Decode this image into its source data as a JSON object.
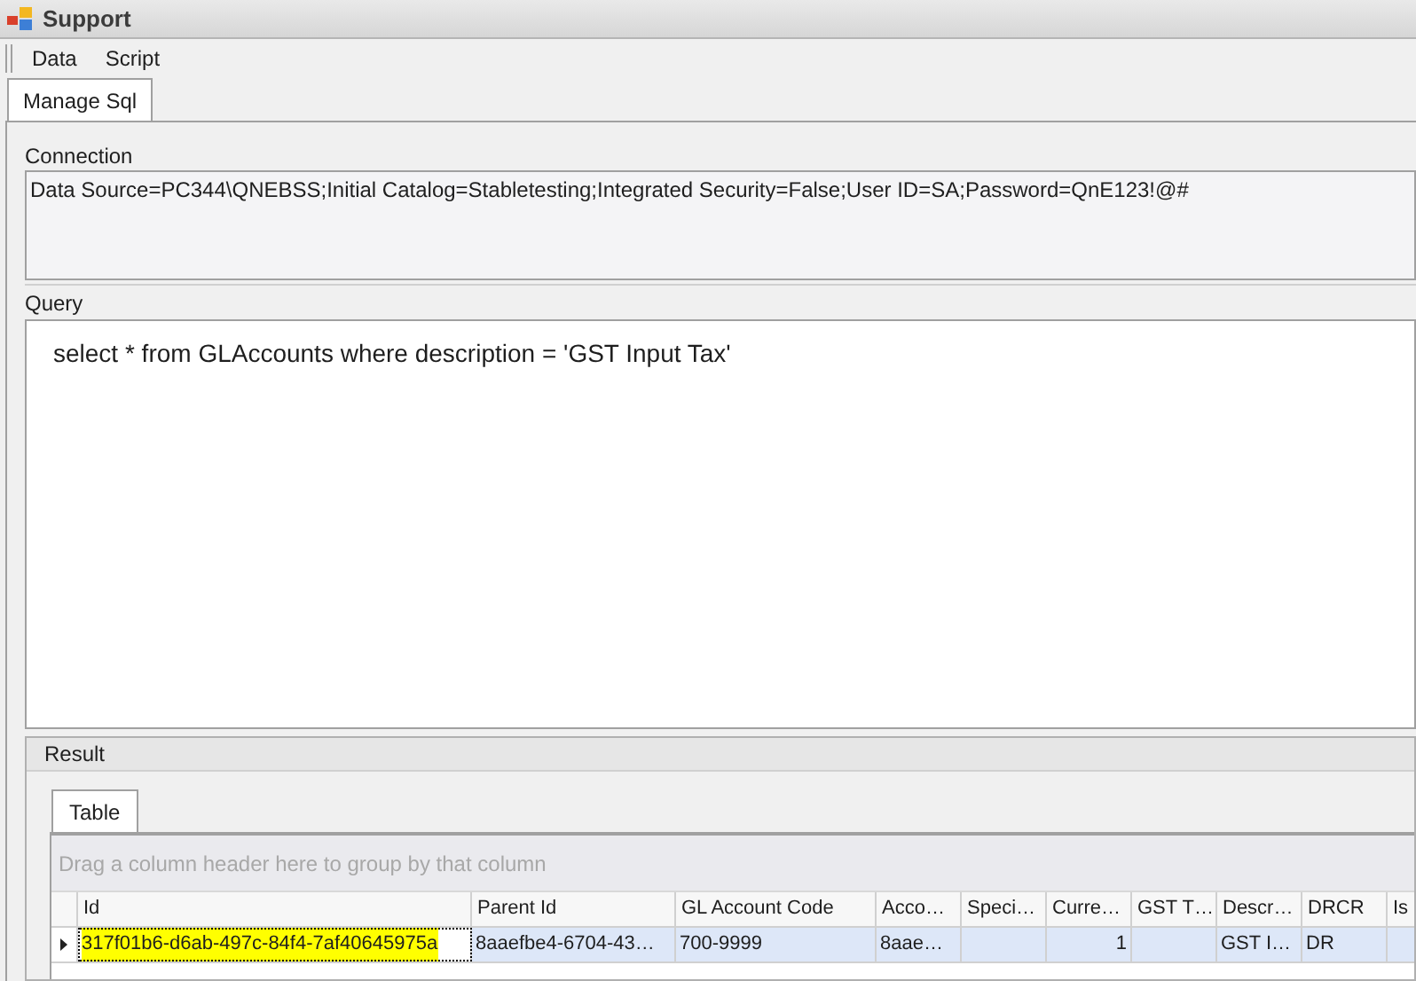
{
  "window": {
    "title": "Support"
  },
  "menu": [
    "Data",
    "Script"
  ],
  "tabs": [
    {
      "label": "Manage Sql",
      "selected": true
    }
  ],
  "connection": {
    "label": "Connection",
    "value": "Data Source=PC344\\QNEBSS;Initial Catalog=Stabletesting;Integrated Security=False;User ID=SA;Password=QnE123!@#"
  },
  "query": {
    "label": "Query",
    "value": "select * from GLAccounts where description = 'GST Input Tax'"
  },
  "result": {
    "label": "Result",
    "tabs": [
      {
        "label": "Table",
        "selected": true
      }
    ],
    "group_panel_hint": "Drag a column header here to group by that column",
    "columns": [
      {
        "label": "Id",
        "kind": "text"
      },
      {
        "label": "Parent Id",
        "kind": "text"
      },
      {
        "label": "GL Account Code",
        "kind": "text"
      },
      {
        "label": "Acco…",
        "kind": "text"
      },
      {
        "label": "Speci…",
        "kind": "text"
      },
      {
        "label": "Curre…",
        "kind": "number"
      },
      {
        "label": "GST T…",
        "kind": "text"
      },
      {
        "label": "Descr…",
        "kind": "text"
      },
      {
        "label": "DRCR",
        "kind": "text"
      },
      {
        "label": "Is",
        "kind": "text"
      }
    ],
    "rows": [
      {
        "selected": true,
        "cells": [
          {
            "text": "317f01b6-d6ab-497c-84f4-7af40645975a",
            "focused": true
          },
          {
            "text": "8aaefbe4-6704-43…",
            "focused": false
          },
          {
            "text": "700-9999",
            "focused": false
          },
          {
            "text": "8aae…",
            "focused": false
          },
          null,
          {
            "text": "1",
            "focused": false
          },
          null,
          {
            "text": "GST I…",
            "focused": false
          },
          {
            "text": "DR",
            "focused": false
          },
          null
        ]
      }
    ]
  }
}
